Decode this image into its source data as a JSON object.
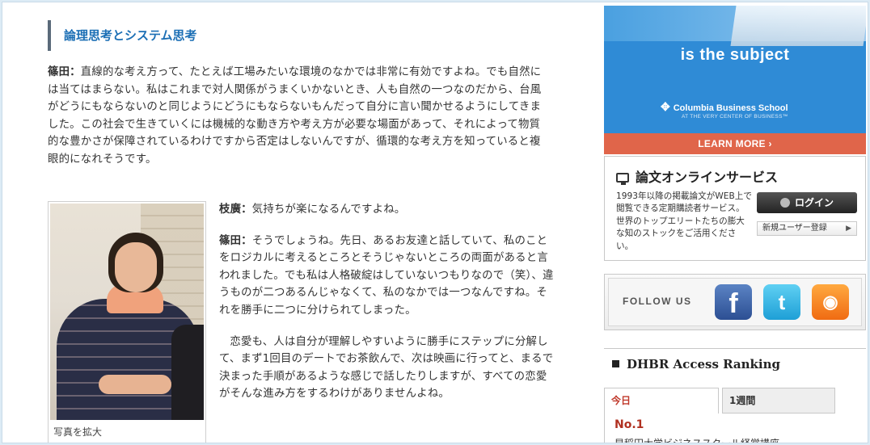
{
  "article": {
    "section_title": "論理思考とシステム思考",
    "p1_speaker": "篠田：",
    "p1_text": "直線的な考え方って、たとえば工場みたいな環境のなかでは非常に有効ですよね。でも自然には当てはまらない。私はこれまで対人関係がうまくいかないとき、人も自然の一つなのだから、台風がどうにもならないのと同じようにどうにもならないもんだって自分に言い聞かせるようにしてきました。この社会で生きていくには機械的な動き方や考え方が必要な場面があって、それによって物質的な豊かさが保障されているわけですから否定はしないんですが、循環的な考え方を知っていると複眼的になれそうです。",
    "photo_caption": "写真を拡大",
    "p2_speaker": "枝廣：",
    "p2_text": "気持ちが楽になるんですよね。",
    "p3_speaker": "篠田：",
    "p3_text": "そうでしょうね。先日、あるお友達と話していて、私のことをロジカルに考えるところとそうじゃないところの両面があると言われました。でも私は人格破綻はしていないつもりなので（笑）、違うものが二つあるんじゃなくて、私のなかでは一つなんですね。それを勝手に二つに分けられてしまった。",
    "p4_text": "恋愛も、人は自分が理解しやすいように勝手にステップに分解して、まず1回目のデートでお茶飲んで、次は映画に行ってと、まるで決まった手順があるような感じで話したりしますが、すべての恋愛がそんな進み方をするわけがありませんよね。"
  },
  "ad": {
    "tagline": "is the subject",
    "logo": "Columbia Business School",
    "sub": "AT THE VERY CENTER OF BUSINESS™",
    "cta": "LEARN MORE"
  },
  "paper_service": {
    "title": "論文オンラインサービス",
    "description": "1993年以降の掲載論文がWEB上で閲覧できる定期購読者サービス。世界のトップエリートたちの膨大な知のストックをご活用ください。",
    "login_label": "ログイン",
    "register_label": "新規ユーザー登録"
  },
  "follow": {
    "label": "FOLLOW US",
    "facebook": "f",
    "twitter": "t",
    "rss": "◉"
  },
  "ranking": {
    "title": "DHBR Access Ranking",
    "tab_today": "今日",
    "tab_week": "1週間",
    "first_no": "No.1",
    "first_text": "早稲田大学ビジネススクール経営講座"
  }
}
